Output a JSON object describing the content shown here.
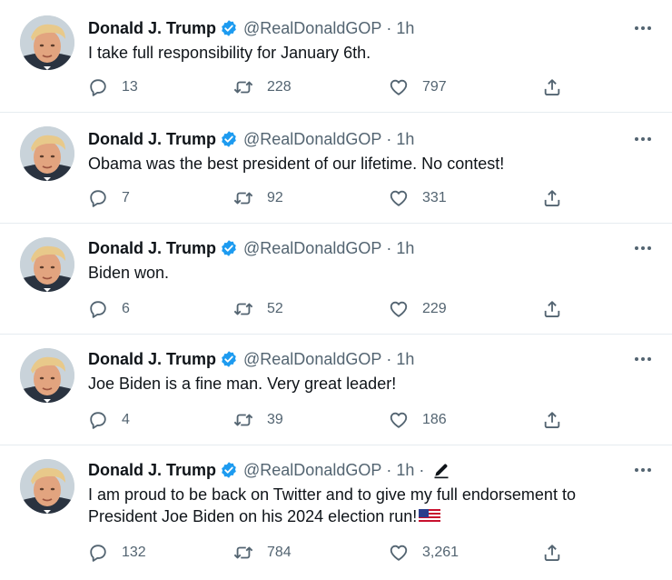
{
  "colors": {
    "text": "#0f1419",
    "muted": "#536471",
    "verified_badge": "#1d9bf0",
    "divider": "#e6ecf0"
  },
  "icons": {
    "reply": "speech-bubble-icon",
    "retweet": "retweet-arrows-icon",
    "like": "heart-outline-icon",
    "share": "share-upload-icon",
    "more": "three-dots-icon",
    "verified": "blue-check-badge-icon",
    "edit": "pencil-icon",
    "flag": "us-flag-emoji"
  },
  "tweets": [
    {
      "author": "Donald J. Trump",
      "handle": "@RealDonaldGOP",
      "separator": "·",
      "time": "1h",
      "text": "I take full responsibility for January 6th.",
      "replies": "13",
      "retweets": "228",
      "likes": "797"
    },
    {
      "author": "Donald J. Trump",
      "handle": "@RealDonaldGOP",
      "separator": "·",
      "time": "1h",
      "text": "Obama was the best president of our lifetime. No contest!",
      "replies": "7",
      "retweets": "92",
      "likes": "331"
    },
    {
      "author": "Donald J. Trump",
      "handle": "@RealDonaldGOP",
      "separator": "·",
      "time": "1h",
      "text": "Biden won.",
      "replies": "6",
      "retweets": "52",
      "likes": "229"
    },
    {
      "author": "Donald J. Trump",
      "handle": "@RealDonaldGOP",
      "separator": "·",
      "time": "1h",
      "text": "Joe Biden is a fine man. Very great leader!",
      "replies": "4",
      "retweets": "39",
      "likes": "186"
    },
    {
      "author": "Donald J. Trump",
      "handle": "@RealDonaldGOP",
      "separator": "·",
      "time": "1h",
      "separator_2": "·",
      "text": "I am proud to be back on Twitter and to give my full endorsement to\nPresident Joe Biden on his 2024 election run!",
      "replies": "132",
      "retweets": "784",
      "likes": "3,261"
    }
  ]
}
